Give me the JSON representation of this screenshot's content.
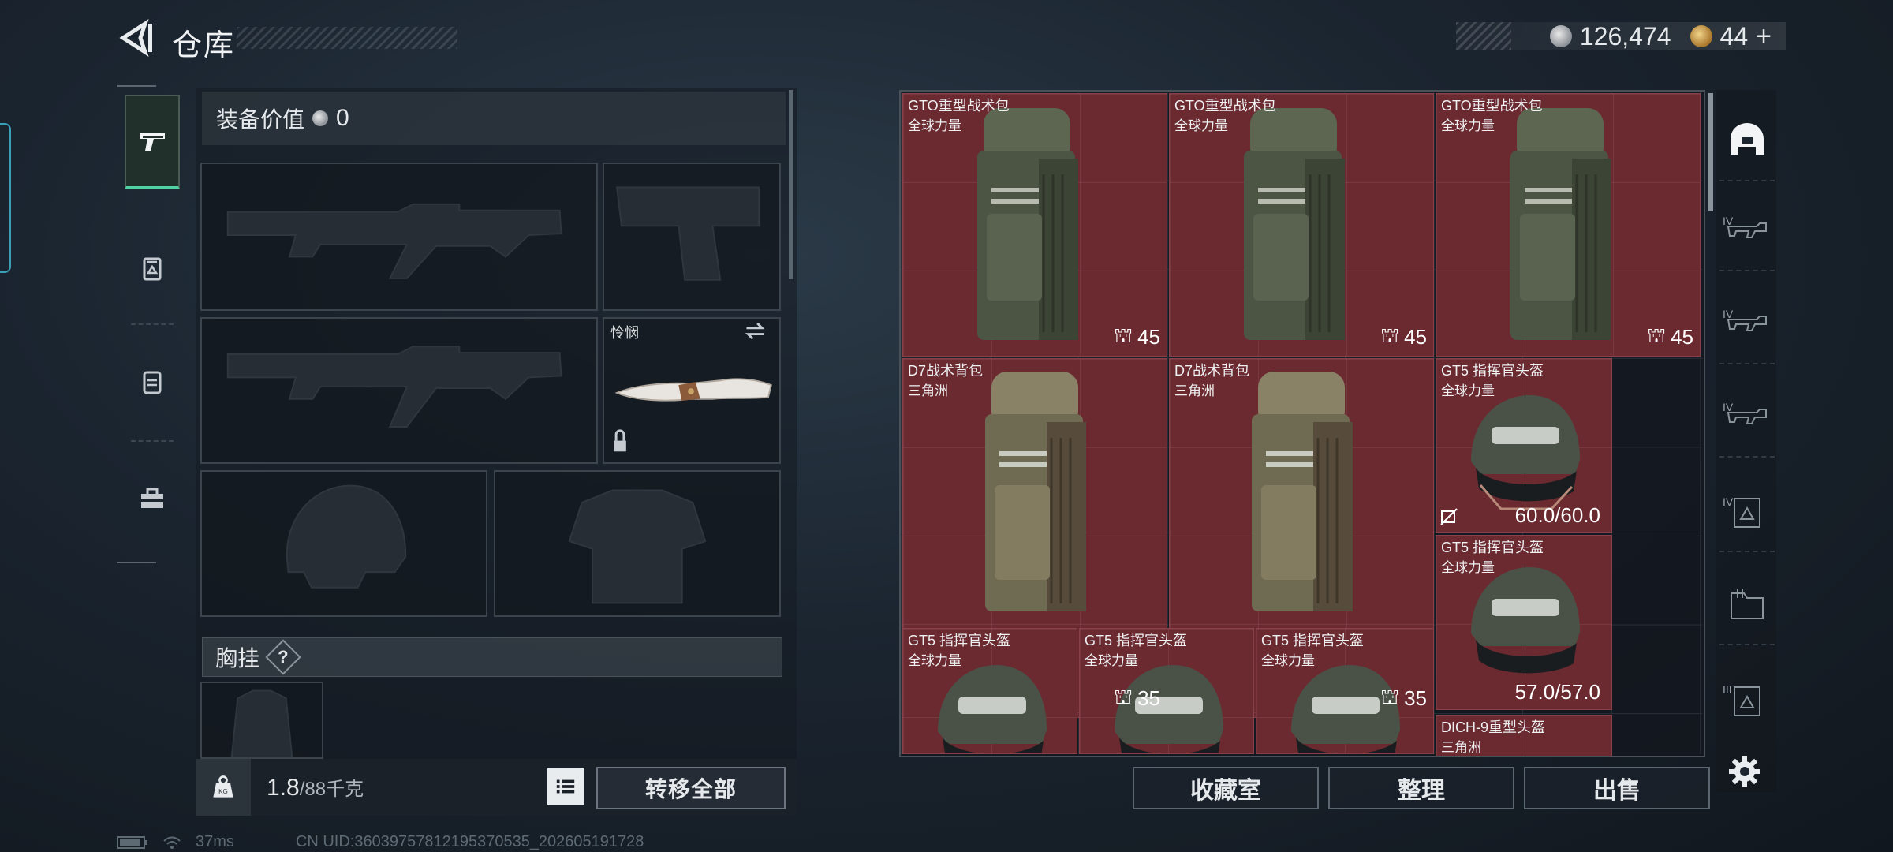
{
  "header": {
    "title": "仓库",
    "currency_silver": "126,474",
    "currency_gold": "44",
    "currency_add": "+"
  },
  "left_tabs": [
    {
      "icon": "pistol-icon",
      "active": true
    },
    {
      "icon": "ammo-case-icon",
      "active": false
    },
    {
      "icon": "backpack-icon",
      "active": false
    },
    {
      "icon": "toolbox-icon",
      "active": false
    }
  ],
  "equipment": {
    "value_label": "装备价值",
    "value": "0",
    "knife_name": "怜悯",
    "chest_rig_label": "胸挂",
    "chest_rig_help": "?"
  },
  "weight": {
    "current": "1.8",
    "max": "/88千克"
  },
  "buttons": {
    "transfer_all": "转移全部",
    "collection": "收藏室",
    "organize": "整理",
    "sell": "出售"
  },
  "items": [
    {
      "name": "GTO重型战术包",
      "source": "全球力量",
      "capacity": "45"
    },
    {
      "name": "GTO重型战术包",
      "source": "全球力量",
      "capacity": "45"
    },
    {
      "name": "GTO重型战术包",
      "source": "全球力量",
      "capacity": "45"
    },
    {
      "name": "D7战术背包",
      "source": "三角洲",
      "capacity": "35"
    },
    {
      "name": "D7战术背包",
      "source": "三角洲",
      "capacity": "35"
    },
    {
      "name": "GT5 指挥官头盔",
      "source": "全球力量",
      "durability": "60.0/60.0"
    },
    {
      "name": "GT5 指挥官头盔",
      "source": "全球力量",
      "durability": "57.0/57.0"
    },
    {
      "name": "GT5 指挥官头盔",
      "source": "全球力量"
    },
    {
      "name": "GT5 指挥官头盔",
      "source": "全球力量"
    },
    {
      "name": "GT5 指挥官头盔",
      "source": "全球力量"
    },
    {
      "name": "DICH-9重型头盔",
      "source": "三角洲"
    }
  ],
  "side_filters": [
    {
      "level": "",
      "icon": "helmet-filter-icon"
    },
    {
      "level": "IV",
      "icon": "rifle-filter-icon"
    },
    {
      "level": "IV",
      "icon": "smg-filter-icon"
    },
    {
      "level": "IV",
      "icon": "shotgun-filter-icon"
    },
    {
      "level": "IV",
      "icon": "armor-filter-icon"
    },
    {
      "level": "",
      "icon": "folder-filter-icon"
    },
    {
      "level": "III",
      "icon": "vest-filter-icon"
    }
  ],
  "status": {
    "ping": "37ms",
    "uid": "CN UID:3603975781219537053​5_202605191728"
  },
  "colors": {
    "accent": "#4fd3a2",
    "item_bg": "#6b2a30"
  }
}
